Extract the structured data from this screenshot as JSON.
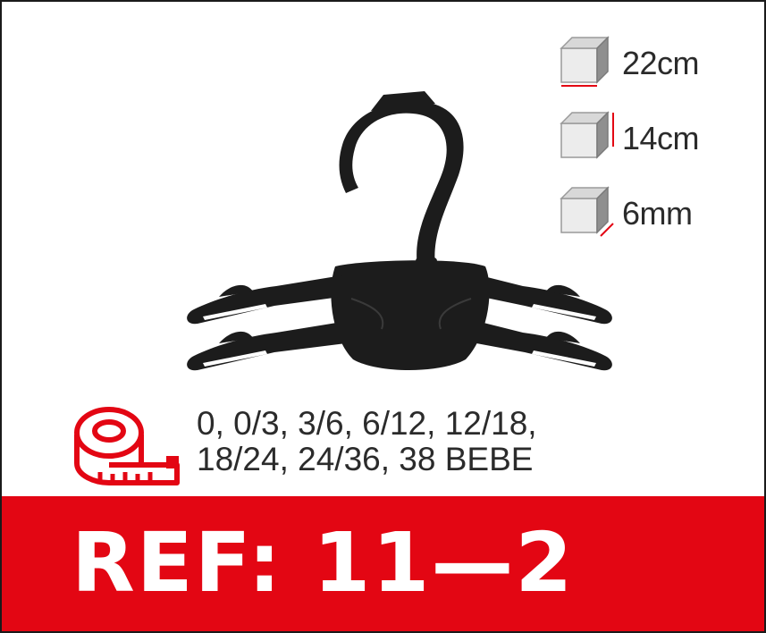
{
  "product": {
    "dimensions": [
      {
        "value": "22cm",
        "icon": "cube-width-icon"
      },
      {
        "value": "14cm",
        "icon": "cube-height-icon"
      },
      {
        "value": "6mm",
        "icon": "cube-depth-icon"
      }
    ],
    "sizes_line1": "0, 0/3, 3/6, 6/12, 12/18,",
    "sizes_line2": "18/24, 24/36, 38 BEBE",
    "reference": "REF: 11—2"
  },
  "colors": {
    "accent": "#e30613",
    "hanger": "#1c1c1c",
    "text": "#2b2b2b",
    "cube_light": "#e9e9e9",
    "cube_dark": "#9a9a9a"
  }
}
